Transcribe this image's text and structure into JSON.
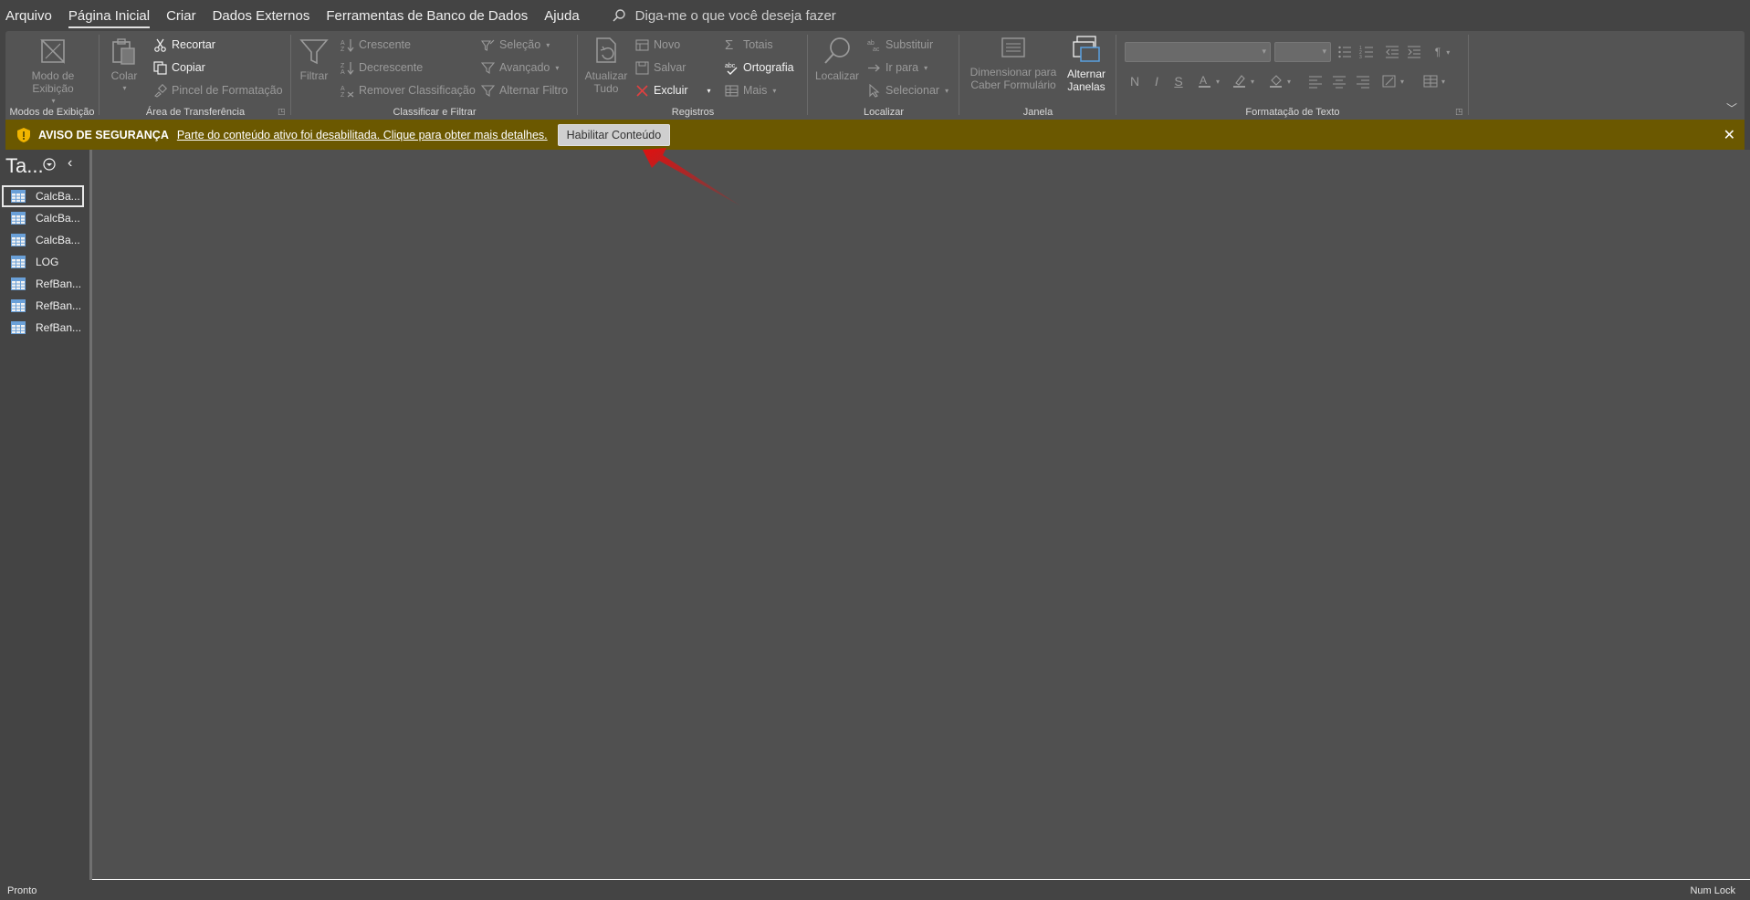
{
  "menu": {
    "tabs": [
      "Arquivo",
      "Página Inicial",
      "Criar",
      "Dados Externos",
      "Ferramentas de Banco de Dados",
      "Ajuda"
    ],
    "active_index": 1,
    "tellme_placeholder": "Diga-me o que você deseja fazer"
  },
  "ribbon": {
    "views": {
      "label": "Modos de Exibição",
      "view_btn_line1": "Modo de",
      "view_btn_line2": "Exibição"
    },
    "clipboard": {
      "label": "Área de Transferência",
      "paste": "Colar",
      "cut": "Recortar",
      "copy": "Copiar",
      "format_painter": "Pincel de Formatação"
    },
    "sort_filter": {
      "label": "Classificar e Filtrar",
      "filter": "Filtrar",
      "ascending": "Crescente",
      "descending": "Decrescente",
      "remove_sort": "Remover Classificação",
      "selection": "Seleção",
      "advanced": "Avançado",
      "toggle_filter": "Alternar Filtro"
    },
    "records": {
      "label": "Registros",
      "refresh_line1": "Atualizar",
      "refresh_line2": "Tudo",
      "new": "Novo",
      "save": "Salvar",
      "delete": "Excluir",
      "totals": "Totais",
      "spelling": "Ortografia",
      "more": "Mais"
    },
    "find": {
      "label": "Localizar",
      "find": "Localizar",
      "replace": "Substituir",
      "goto": "Ir para",
      "select": "Selecionar"
    },
    "window": {
      "label": "Janela",
      "size_line1": "Dimensionar para",
      "size_line2": "Caber Formulário",
      "switch_line1": "Alternar",
      "switch_line2": "Janelas"
    },
    "text_format": {
      "label": "Formatação de Texto",
      "bold": "N",
      "italic": "I",
      "underline": "S"
    }
  },
  "security": {
    "title": "AVISO DE SEGURANÇA",
    "message": "Parte do conteúdo ativo foi desabilitada. Clique para obter mais detalhes.",
    "button": "Habilitar Conteúdo",
    "bar_color": "#6b5800"
  },
  "nav": {
    "title": "Ta...",
    "items": [
      "CalcBa...",
      "CalcBa...",
      "CalcBa...",
      "LOG",
      "RefBan...",
      "RefBan...",
      "RefBan..."
    ],
    "selected_index": 0
  },
  "status": {
    "left": "Pronto",
    "right": "Num Lock"
  },
  "colors": {
    "annotation_arrow": "#e01010"
  }
}
